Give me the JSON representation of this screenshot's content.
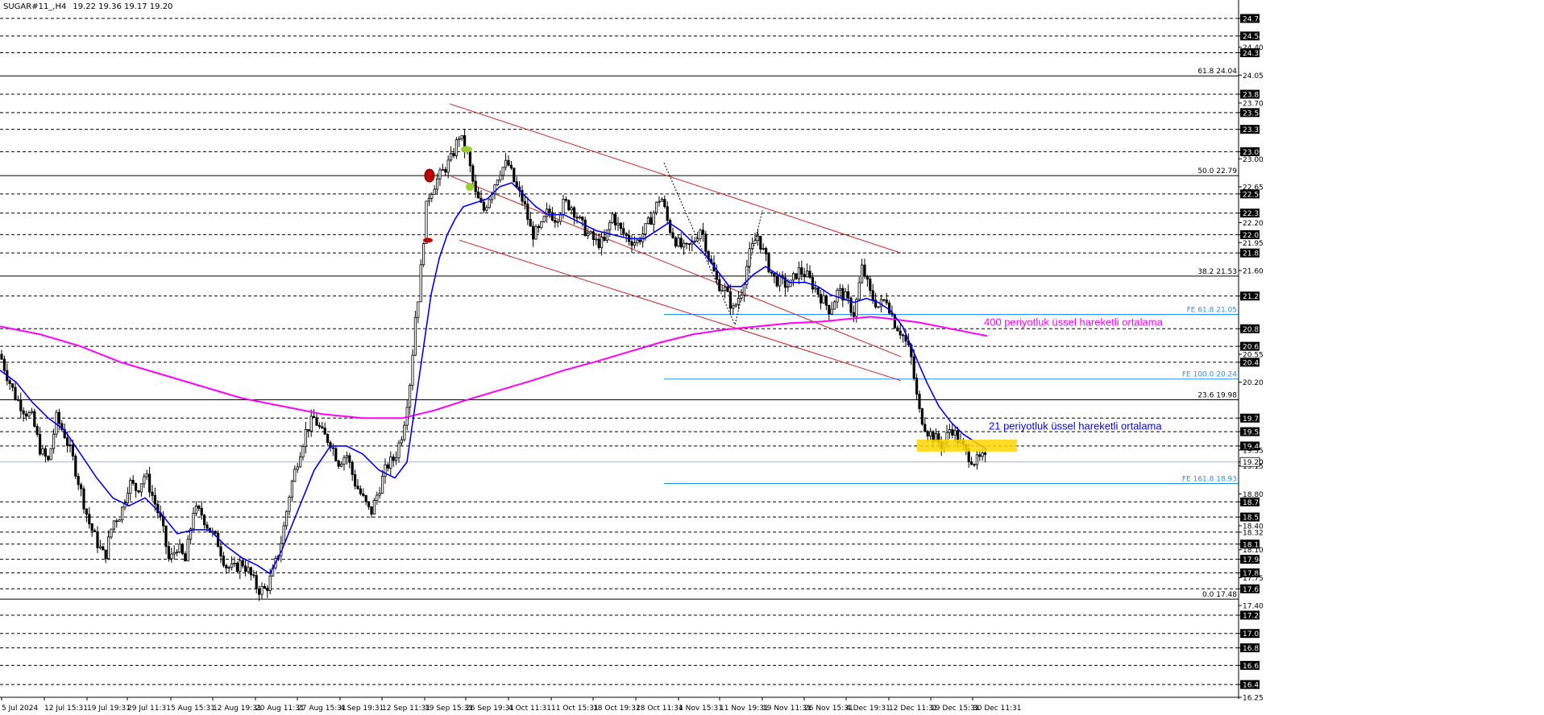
{
  "header": {
    "symbol": "SUGAR#11_,H4",
    "ohlc": "19.22 19.36 19.17 19.20"
  },
  "colors": {
    "background": "#ffffff",
    "candle_bull": "#000000",
    "candle_bear": "#000000",
    "ema21": "#0000ff",
    "ema400": "#ff00ff",
    "channel": "#d02020",
    "fib_retracement": "#000000",
    "fib_expansion": "#1e90ff",
    "horizontal_dashed": "#000000",
    "price_box": "#000000",
    "highlight_zone": "#ffd700"
  },
  "chart_data": {
    "type": "candlestick",
    "timeframe": "H4",
    "ylim": [
      16.25,
      24.85
    ],
    "x_tick_labels": [
      "5 Jul 2024",
      "12 Jul 15:31",
      "19 Jul 19:31",
      "29 Jul 11:31",
      "5 Aug 15:31",
      "12 Aug 19:31",
      "20 Aug 11:31",
      "27 Aug 15:31",
      "4 Sep 19:31",
      "12 Sep 11:31",
      "19 Sep 15:31",
      "26 Sep 19:31",
      "4 Oct 11:31",
      "11 Oct 15:31",
      "18 Oct 19:31",
      "28 Oct 11:31",
      "4 Nov 15:31",
      "11 Nov 19:31",
      "19 Nov 11:31",
      "26 Nov 15:31",
      "4 Dec 19:31",
      "12 Dec 11:31",
      "19 Dec 15:31",
      "30 Dec 11:31"
    ],
    "y_tick_labels": [
      "24.76",
      "24.54",
      "24.40",
      "24.33",
      "24.05",
      "23.81",
      "23.70",
      "23.58",
      "23.37",
      "23.09",
      "23.00",
      "22.65",
      "22.56",
      "22.32",
      "22.20",
      "22.05",
      "21.95",
      "21.82",
      "21.60",
      "21.28",
      "20.87",
      "20.65",
      "20.55",
      "20.45",
      "20.20",
      "19.75",
      "19.58",
      "19.40",
      "19.35",
      "19.20",
      "19.15",
      "18.80",
      "18.70",
      "18.51",
      "18.40",
      "18.32",
      "18.17",
      "18.10",
      "17.98",
      "17.81",
      "17.75",
      "17.61",
      "17.40",
      "17.28",
      "17.05",
      "16.87",
      "16.65",
      "16.41",
      "16.25"
    ],
    "boxed_prices": [
      "24.76",
      "24.54",
      "24.33",
      "23.81",
      "23.58",
      "23.37",
      "23.09",
      "22.56",
      "22.32",
      "22.05",
      "21.82",
      "21.28",
      "20.87",
      "20.65",
      "20.45",
      "19.75",
      "19.58",
      "19.40",
      "18.70",
      "18.51",
      "18.17",
      "17.98",
      "17.81",
      "17.61",
      "17.28",
      "17.05",
      "16.87",
      "16.65",
      "16.41"
    ],
    "current_price": "19.20",
    "dashed_levels": [
      24.76,
      24.54,
      24.33,
      23.81,
      23.58,
      23.37,
      23.09,
      22.56,
      22.32,
      22.05,
      21.82,
      21.28,
      20.87,
      20.65,
      20.45,
      19.75,
      19.58,
      19.4,
      18.7,
      18.51,
      18.32,
      18.17,
      17.98,
      17.81,
      17.61,
      17.28,
      17.05,
      16.87,
      16.65,
      16.41
    ],
    "fib_retracement": [
      {
        "label": "61.8 24.04",
        "price": 24.04
      },
      {
        "label": "50.0 22.79",
        "price": 22.79
      },
      {
        "label": "38.2 21.53",
        "price": 21.53
      },
      {
        "label": "23.6 19.98",
        "price": 19.98
      },
      {
        "label": "0.0 17.48",
        "price": 17.48
      }
    ],
    "fib_expansion": [
      {
        "label": "FE 61.8 21.05",
        "price": 21.05
      },
      {
        "label": "FE 100.0 20.24",
        "price": 20.24
      },
      {
        "label": "FE 161.8 18.93",
        "price": 18.93
      }
    ],
    "close_path": [
      [
        0,
        20.55
      ],
      [
        10,
        20.25
      ],
      [
        20,
        20.0
      ],
      [
        30,
        19.85
      ],
      [
        40,
        19.75
      ],
      [
        50,
        19.35
      ],
      [
        60,
        19.2
      ],
      [
        70,
        19.75
      ],
      [
        80,
        19.55
      ],
      [
        90,
        19.25
      ],
      [
        100,
        18.85
      ],
      [
        110,
        18.45
      ],
      [
        120,
        18.2
      ],
      [
        130,
        18.0
      ],
      [
        140,
        18.45
      ],
      [
        150,
        18.55
      ],
      [
        160,
        18.95
      ],
      [
        170,
        18.85
      ],
      [
        180,
        19.05
      ],
      [
        190,
        18.75
      ],
      [
        200,
        18.45
      ],
      [
        210,
        17.95
      ],
      [
        220,
        18.15
      ],
      [
        230,
        17.95
      ],
      [
        240,
        18.6
      ],
      [
        250,
        18.55
      ],
      [
        260,
        18.35
      ],
      [
        270,
        18.2
      ],
      [
        280,
        17.9
      ],
      [
        290,
        17.85
      ],
      [
        300,
        17.95
      ],
      [
        310,
        17.8
      ],
      [
        320,
        17.6
      ],
      [
        330,
        17.6
      ],
      [
        340,
        17.85
      ],
      [
        350,
        18.25
      ],
      [
        360,
        18.85
      ],
      [
        370,
        19.25
      ],
      [
        380,
        19.6
      ],
      [
        390,
        19.75
      ],
      [
        400,
        19.55
      ],
      [
        410,
        19.45
      ],
      [
        420,
        19.2
      ],
      [
        430,
        19.3
      ],
      [
        440,
        18.95
      ],
      [
        450,
        18.75
      ],
      [
        460,
        18.55
      ],
      [
        470,
        18.85
      ],
      [
        480,
        19.15
      ],
      [
        490,
        19.25
      ],
      [
        500,
        19.6
      ],
      [
        510,
        20.3
      ],
      [
        515,
        21.0
      ],
      [
        520,
        21.35
      ],
      [
        525,
        21.95
      ],
      [
        530,
        22.5
      ],
      [
        540,
        22.7
      ],
      [
        550,
        22.85
      ],
      [
        560,
        23.0
      ],
      [
        570,
        23.3
      ],
      [
        580,
        23.05
      ],
      [
        590,
        22.55
      ],
      [
        600,
        22.35
      ],
      [
        610,
        22.6
      ],
      [
        620,
        22.85
      ],
      [
        630,
        22.95
      ],
      [
        640,
        22.65
      ],
      [
        650,
        22.45
      ],
      [
        660,
        22.05
      ],
      [
        670,
        22.1
      ],
      [
        680,
        22.35
      ],
      [
        690,
        22.25
      ],
      [
        700,
        22.45
      ],
      [
        710,
        22.4
      ],
      [
        720,
        22.2
      ],
      [
        730,
        22.05
      ],
      [
        740,
        21.95
      ],
      [
        750,
        21.95
      ],
      [
        760,
        22.3
      ],
      [
        770,
        22.1
      ],
      [
        780,
        22.0
      ],
      [
        790,
        21.95
      ],
      [
        800,
        22.1
      ],
      [
        810,
        22.3
      ],
      [
        820,
        22.55
      ],
      [
        830,
        22.15
      ],
      [
        840,
        21.95
      ],
      [
        850,
        21.85
      ],
      [
        860,
        21.95
      ],
      [
        870,
        22.15
      ],
      [
        880,
        21.75
      ],
      [
        890,
        21.45
      ],
      [
        900,
        21.35
      ],
      [
        910,
        21.1
      ],
      [
        920,
        21.35
      ],
      [
        930,
        21.8
      ],
      [
        940,
        22.05
      ],
      [
        950,
        21.75
      ],
      [
        960,
        21.5
      ],
      [
        970,
        21.45
      ],
      [
        980,
        21.4
      ],
      [
        990,
        21.6
      ],
      [
        1000,
        21.55
      ],
      [
        1010,
        21.4
      ],
      [
        1020,
        21.25
      ],
      [
        1030,
        21.1
      ],
      [
        1040,
        21.35
      ],
      [
        1050,
        21.25
      ],
      [
        1060,
        21.05
      ],
      [
        1070,
        21.65
      ],
      [
        1080,
        21.3
      ],
      [
        1090,
        21.15
      ],
      [
        1100,
        21.25
      ],
      [
        1110,
        20.95
      ],
      [
        1120,
        20.8
      ],
      [
        1130,
        20.55
      ],
      [
        1135,
        20.2
      ],
      [
        1140,
        19.85
      ],
      [
        1150,
        19.6
      ],
      [
        1160,
        19.5
      ],
      [
        1170,
        19.4
      ],
      [
        1180,
        19.65
      ],
      [
        1190,
        19.45
      ],
      [
        1200,
        19.3
      ],
      [
        1210,
        19.2
      ],
      [
        1220,
        19.25
      ],
      [
        1225,
        19.2
      ]
    ],
    "series": [
      {
        "name": "21 periyotluk üssel hareketli ortalama",
        "points": [
          [
            0,
            20.35
          ],
          [
            20,
            20.2
          ],
          [
            40,
            19.95
          ],
          [
            60,
            19.75
          ],
          [
            80,
            19.6
          ],
          [
            100,
            19.3
          ],
          [
            120,
            19.0
          ],
          [
            140,
            18.75
          ],
          [
            160,
            18.65
          ],
          [
            180,
            18.75
          ],
          [
            200,
            18.55
          ],
          [
            220,
            18.3
          ],
          [
            240,
            18.35
          ],
          [
            260,
            18.35
          ],
          [
            280,
            18.15
          ],
          [
            300,
            18.0
          ],
          [
            320,
            17.9
          ],
          [
            335,
            17.8
          ],
          [
            350,
            18.1
          ],
          [
            370,
            18.6
          ],
          [
            390,
            19.1
          ],
          [
            410,
            19.4
          ],
          [
            430,
            19.4
          ],
          [
            450,
            19.3
          ],
          [
            470,
            19.1
          ],
          [
            490,
            19.0
          ],
          [
            505,
            19.2
          ],
          [
            515,
            19.9
          ],
          [
            525,
            20.6
          ],
          [
            535,
            21.3
          ],
          [
            545,
            21.75
          ],
          [
            555,
            22.05
          ],
          [
            565,
            22.25
          ],
          [
            575,
            22.4
          ],
          [
            590,
            22.45
          ],
          [
            605,
            22.5
          ],
          [
            620,
            22.65
          ],
          [
            635,
            22.7
          ],
          [
            650,
            22.55
          ],
          [
            665,
            22.4
          ],
          [
            680,
            22.3
          ],
          [
            700,
            22.3
          ],
          [
            720,
            22.2
          ],
          [
            740,
            22.1
          ],
          [
            760,
            22.05
          ],
          [
            780,
            22.0
          ],
          [
            800,
            22.0
          ],
          [
            815,
            22.1
          ],
          [
            830,
            22.2
          ],
          [
            845,
            22.1
          ],
          [
            860,
            21.95
          ],
          [
            875,
            21.8
          ],
          [
            890,
            21.6
          ],
          [
            905,
            21.4
          ],
          [
            920,
            21.4
          ],
          [
            935,
            21.55
          ],
          [
            950,
            21.65
          ],
          [
            965,
            21.55
          ],
          [
            980,
            21.45
          ],
          [
            1000,
            21.45
          ],
          [
            1015,
            21.4
          ],
          [
            1030,
            21.3
          ],
          [
            1045,
            21.25
          ],
          [
            1060,
            21.2
          ],
          [
            1075,
            21.25
          ],
          [
            1090,
            21.2
          ],
          [
            1105,
            21.1
          ],
          [
            1120,
            20.9
          ],
          [
            1135,
            20.55
          ],
          [
            1150,
            20.2
          ],
          [
            1165,
            19.9
          ],
          [
            1180,
            19.7
          ],
          [
            1195,
            19.55
          ],
          [
            1210,
            19.45
          ],
          [
            1225,
            19.35
          ]
        ]
      },
      {
        "name": "400 periyotluk üssel hareketli ortalama",
        "points": [
          [
            0,
            20.9
          ],
          [
            50,
            20.8
          ],
          [
            100,
            20.65
          ],
          [
            150,
            20.45
          ],
          [
            200,
            20.3
          ],
          [
            250,
            20.15
          ],
          [
            300,
            20.0
          ],
          [
            350,
            19.9
          ],
          [
            400,
            19.8
          ],
          [
            450,
            19.75
          ],
          [
            500,
            19.75
          ],
          [
            540,
            19.85
          ],
          [
            580,
            19.98
          ],
          [
            620,
            20.1
          ],
          [
            660,
            20.22
          ],
          [
            700,
            20.35
          ],
          [
            740,
            20.46
          ],
          [
            780,
            20.58
          ],
          [
            820,
            20.7
          ],
          [
            860,
            20.8
          ],
          [
            900,
            20.86
          ],
          [
            940,
            20.9
          ],
          [
            980,
            20.94
          ],
          [
            1020,
            20.96
          ],
          [
            1060,
            21.0
          ],
          [
            1080,
            21.02
          ],
          [
            1100,
            21.0
          ],
          [
            1140,
            20.95
          ],
          [
            1180,
            20.87
          ],
          [
            1225,
            20.78
          ]
        ]
      }
    ]
  },
  "annotations": {
    "ema400_label": "400 periyotluk üssel hareketli ortalama",
    "ema21_label": "21 periyotluk üssel hareketli ortalama"
  }
}
